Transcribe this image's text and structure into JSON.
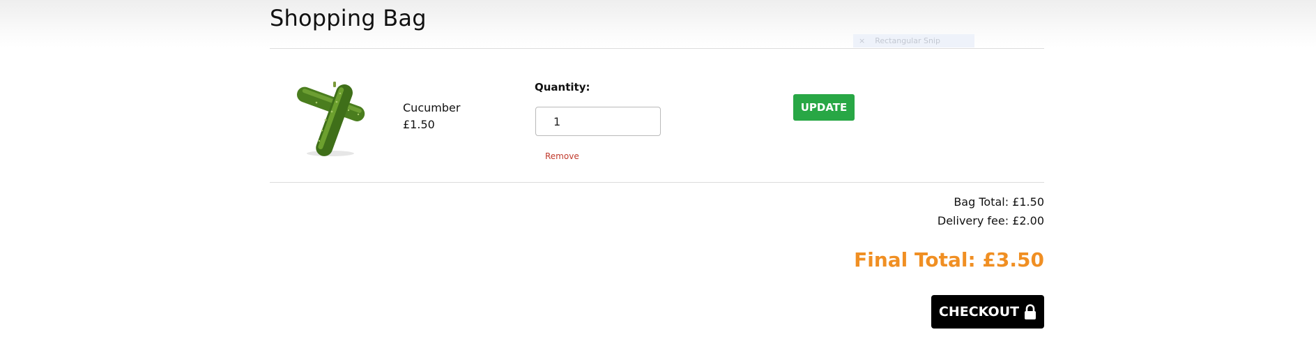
{
  "page": {
    "title": "Shopping Bag"
  },
  "overlay": {
    "icon": "close-icon",
    "close_glyph": "×",
    "label": "Rectangular Snip"
  },
  "bag_item": {
    "image_icon": "cucumber-image",
    "name": "Cucumber",
    "price": "£1.50",
    "quantity_label": "Quantity:",
    "quantity_value": "1",
    "remove_label": "Remove",
    "update_label": "UPDATE"
  },
  "summary": {
    "bag_total": "Bag Total: £1.50",
    "delivery_fee": "Delivery fee: £2.00",
    "final_total": "Final Total: £3.50"
  },
  "checkout": {
    "label": "CHECKOUT",
    "icon": "lock-icon"
  },
  "colors": {
    "update_button": "#28a745",
    "final_total": "#f08f23",
    "remove_link": "#c0392b",
    "checkout_button": "#000000"
  }
}
